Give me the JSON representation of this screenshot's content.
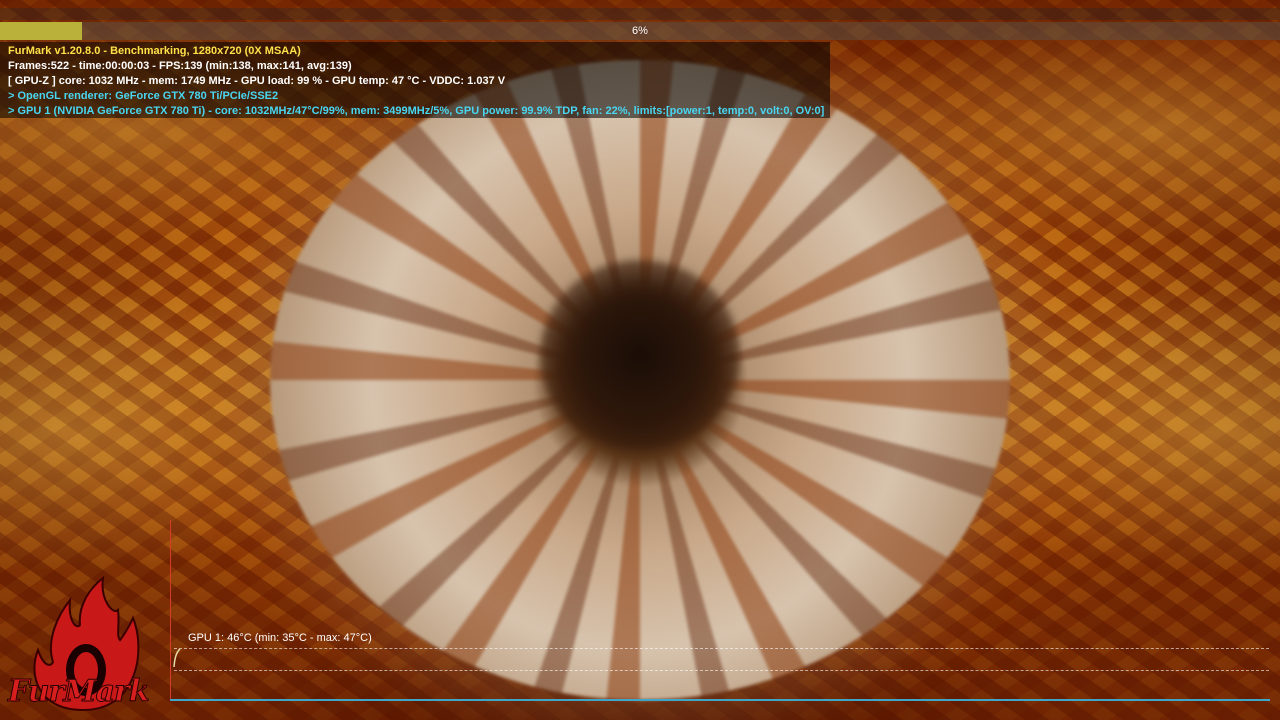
{
  "progress": {
    "percent_label": "6%",
    "fraction": 0.064
  },
  "osd": {
    "line1": "FurMark v1.20.8.0 - Benchmarking, 1280x720 (0X MSAA)",
    "line2": "Frames:522 - time:00:00:03 - FPS:139 (min:138, max:141, avg:139)",
    "line3": "[ GPU-Z ] core: 1032 MHz - mem: 1749 MHz - GPU load: 99 % - GPU temp: 47 °C - VDDC: 1.037 V",
    "line4": "> OpenGL renderer: GeForce GTX 780 Ti/PCIe/SSE2",
    "line5": "> GPU 1 (NVIDIA GeForce GTX 780 Ti) - core: 1032MHz/47°C/99%, mem: 3499MHz/5%, GPU power: 99.9% TDP, fan: 22%, limits:[power:1, temp:0, volt:0, OV:0]"
  },
  "graph": {
    "label": "GPU 1: 46°C (min: 35°C - max: 47°C)"
  },
  "logo": {
    "wordmark": "FurMark"
  },
  "colors": {
    "osd_title": "#ffe24a",
    "osd_info": "#49d6f2",
    "progress_fill": "#b9b13a",
    "graph_axis_y": "#d83a2a",
    "graph_axis_x": "#3ea7c9",
    "logo_red": "#d71f1f"
  }
}
